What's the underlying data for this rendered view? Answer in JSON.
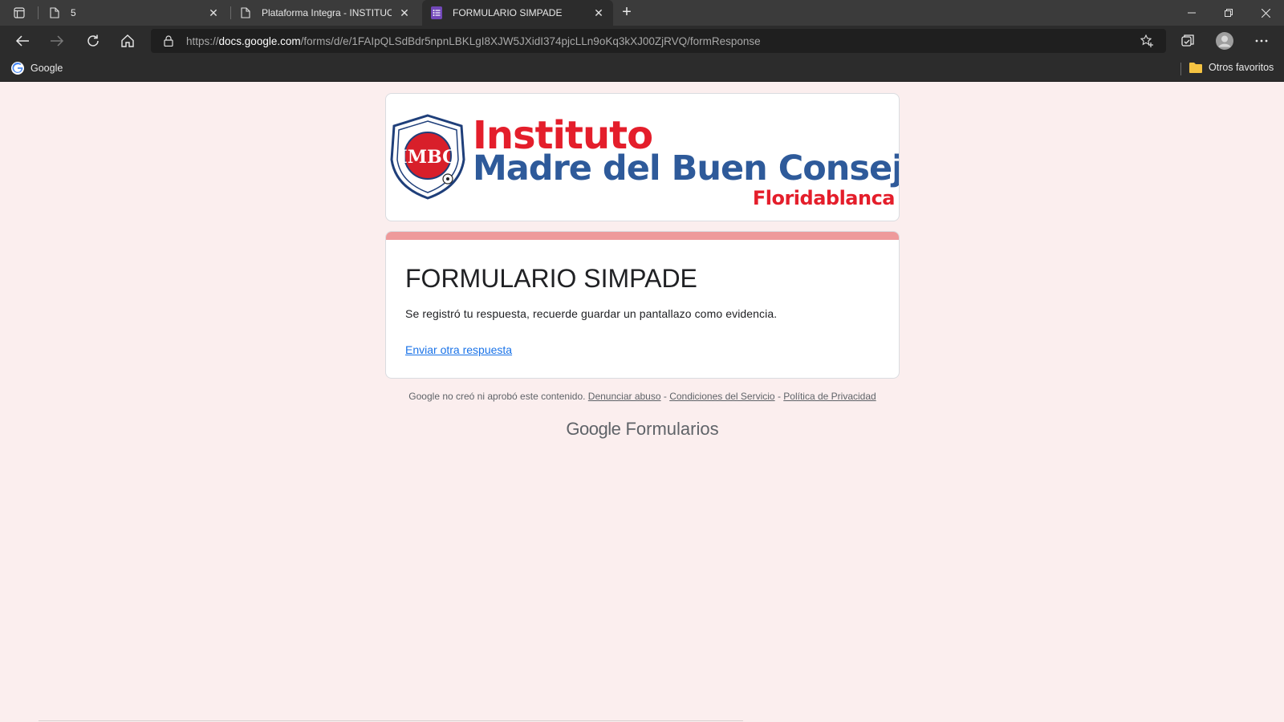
{
  "browser": {
    "tabs": [
      {
        "title": "5",
        "active": false
      },
      {
        "title": "Plataforma Integra - INSTITUCIÓ",
        "active": false
      },
      {
        "title": "FORMULARIO SIMPADE",
        "active": true
      }
    ],
    "address": {
      "scheme": "https://",
      "host": "docs.google.com",
      "path": "/forms/d/e/1FAIpQLSdBdr5npnLBKLgI8XJW5JXidI374pjcLLn9oKq3kXJ00ZjRVQ/formResponse"
    },
    "bookmarks": {
      "google_label": "Google",
      "other_label": "Otros favoritos"
    }
  },
  "header_image": {
    "line1": "Instituto",
    "line2": "Madre del Buen Consejo",
    "line3": "Floridablanca",
    "crest_text": "IMBC"
  },
  "form": {
    "title": "FORMULARIO SIMPADE",
    "message": "Se registró tu respuesta, recuerde guardar un pantallazo como evidencia.",
    "another_response_link": "Enviar otra respuesta",
    "accent_color": "#ee9a9b"
  },
  "footer": {
    "disclaimer": "Google no creó ni aprobó este contenido.",
    "report_abuse": "Denunciar abuso",
    "sep1": " - ",
    "terms": "Condiciones del Servicio",
    "sep2": " - ",
    "privacy": "Política de Privacidad",
    "brand_google": "Google",
    "brand_product": "Formularios"
  }
}
